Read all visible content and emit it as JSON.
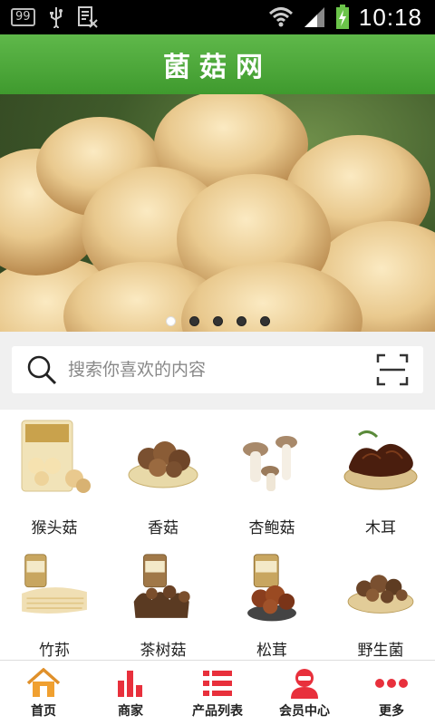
{
  "status_bar": {
    "notification_badge": "99",
    "time": "10:18",
    "icons": [
      "usb-icon",
      "news-icon",
      "wifi-icon",
      "signal-icon",
      "battery-charging-icon"
    ]
  },
  "header": {
    "title": "菌菇网"
  },
  "banner": {
    "slides": 5,
    "active_slide": 1
  },
  "search": {
    "placeholder": "搜索你喜欢的内容"
  },
  "categories": [
    {
      "label": "猴头菇",
      "icon": "hericium-product-image"
    },
    {
      "label": "香菇",
      "icon": "shiitake-product-image"
    },
    {
      "label": "杏鲍菇",
      "icon": "king-oyster-product-image"
    },
    {
      "label": "木耳",
      "icon": "wood-ear-product-image"
    },
    {
      "label": "竹荪",
      "icon": "bamboo-fungus-product-image"
    },
    {
      "label": "茶树菇",
      "icon": "tea-tree-mushroom-product-image"
    },
    {
      "label": "松茸",
      "icon": "matsutake-product-image"
    },
    {
      "label": "野生菌",
      "icon": "wild-mushroom-product-image"
    }
  ],
  "bottom_nav": [
    {
      "label": "首页",
      "icon": "home-icon"
    },
    {
      "label": "商家",
      "icon": "bar-chart-icon"
    },
    {
      "label": "产品列表",
      "icon": "list-icon"
    },
    {
      "label": "会员中心",
      "icon": "user-icon"
    },
    {
      "label": "更多",
      "icon": "more-dots-icon"
    }
  ],
  "colors": {
    "header_green": "#4caa38",
    "accent_red": "#e8303c",
    "home_orange": "#f0a030"
  }
}
